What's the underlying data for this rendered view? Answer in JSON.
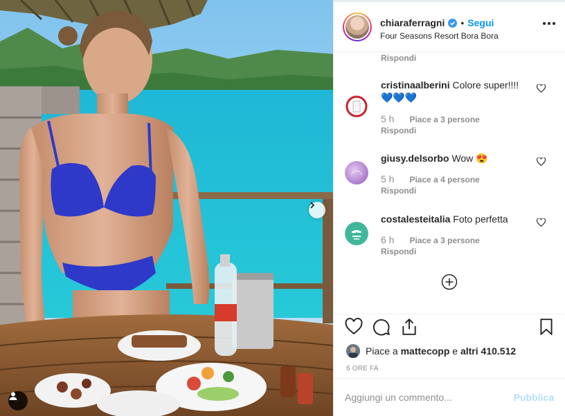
{
  "post": {
    "username": "chiaraferragni",
    "follow_label": "Segui",
    "separator": "•",
    "location": "Four Seasons Resort Bora Bora",
    "more_icon": "more-horizontal-icon"
  },
  "comments": {
    "top_reply_label": "Rispondi",
    "items": [
      {
        "username": "cristinaalberini",
        "text": "Colore super!!!!",
        "emoji": "💙💙💙",
        "time": "5 h",
        "likes": "Piace a 3 persone",
        "reply": "Rispondi"
      },
      {
        "username": "giusy.delsorbo",
        "text": "Wow",
        "emoji": "😍",
        "time": "5 h",
        "likes": "Piace a 4 persone",
        "reply": "Rispondi"
      },
      {
        "username": "costalesteitalia",
        "text": "Foto perfetta",
        "emoji": "",
        "time": "6 h",
        "likes": "Piace a 3 persone",
        "reply": "Rispondi"
      }
    ]
  },
  "likes_summary": {
    "prefix": "Piace a",
    "user": "mattecopp",
    "connector": "e",
    "others": "altri 410.512"
  },
  "time_ago": "6 ORE FA",
  "composer": {
    "placeholder": "Aggiungi un commento...",
    "publish_label": "Pubblica"
  },
  "colors": {
    "link_blue": "#0095f6",
    "publish_disabled": "#b2dffc",
    "muted": "#8e8e8e",
    "text": "#262626"
  }
}
